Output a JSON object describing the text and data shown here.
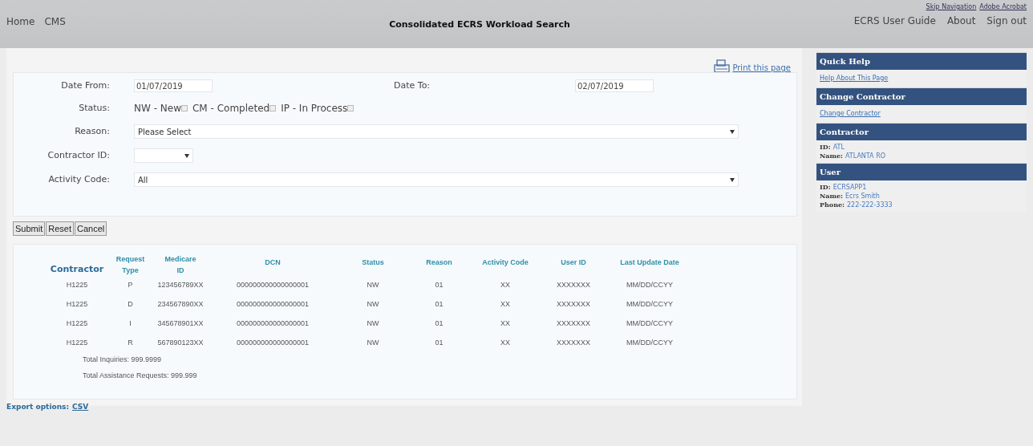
{
  "header": {
    "left_links": [
      "Home",
      "CMS"
    ],
    "title": "Consolidated ECRS Workload Search",
    "top_links": [
      "Skip Navigation",
      "Adobe Acrobat"
    ],
    "right_links": [
      "ECRS User Guide",
      "About",
      "Sign out"
    ]
  },
  "print_link": "Print this page",
  "form": {
    "date_from": {
      "label": "Date From:",
      "value": "01/07/2019"
    },
    "date_to": {
      "label": "Date To:",
      "value": "02/07/2019"
    },
    "status": {
      "label": "Status:",
      "options": [
        {
          "label": "NW - New",
          "checked": false
        },
        {
          "label": "CM - Completed",
          "checked": false
        },
        {
          "label": "IP - In Process",
          "checked": false
        }
      ]
    },
    "reason": {
      "label": "Reason:",
      "value": "Please Select"
    },
    "contractor_id": {
      "label": "Contractor ID:"
    },
    "activity_code": {
      "label": "Activity Code:",
      "value": "All"
    }
  },
  "buttons": [
    "Submit",
    "Reset",
    "Cancel"
  ],
  "table": {
    "columns": [
      "Contractor",
      "Request Type",
      "Medicare ID",
      "DCN",
      "Status",
      "Reason",
      "Activity Code",
      "User ID",
      "Last Update Date"
    ],
    "rows": [
      [
        "H1225",
        "P",
        "123456789XX",
        "000000000000000001",
        "NW",
        "01",
        "XX",
        "XXXXXXX",
        "MM/DD/CCYY"
      ],
      [
        "H1225",
        "D",
        "234567890XX",
        "000000000000000001",
        "NW",
        "01",
        "XX",
        "XXXXXXX",
        "MM/DD/CCYY"
      ],
      [
        "H1225",
        "I",
        "345678901XX",
        "000000000000000001",
        "NW",
        "01",
        "XX",
        "XXXXXXX",
        "MM/DD/CCYY"
      ],
      [
        "H1225",
        "R",
        "567890123XX",
        "000000000000000001",
        "NW",
        "01",
        "XX",
        "XXXXXXX",
        "MM/DD/CCYY"
      ]
    ],
    "totals": [
      "Total Inquiries: 999.9999",
      "Total Assistance Requests: 999.999"
    ]
  },
  "export": {
    "label": "Export options:",
    "link": "CSV"
  },
  "sidebar": [
    {
      "title": "Quick Help",
      "kind": "link",
      "link": "Help About This Page"
    },
    {
      "title": "Change Contractor",
      "kind": "link",
      "link": "Change Contractor"
    },
    {
      "title": "Contractor",
      "kind": "info",
      "fields": [
        {
          "label": "ID:",
          "value": "ATL"
        },
        {
          "label": "Name:",
          "value": "ATLANTA RO"
        }
      ]
    },
    {
      "title": "User",
      "kind": "info",
      "fields": [
        {
          "label": "ID:",
          "value": "ECRSAPP1"
        },
        {
          "label": "Name:",
          "value": "Ecrs Smith"
        },
        {
          "label": "Phone:",
          "value": "222-222-3333"
        }
      ]
    }
  ]
}
